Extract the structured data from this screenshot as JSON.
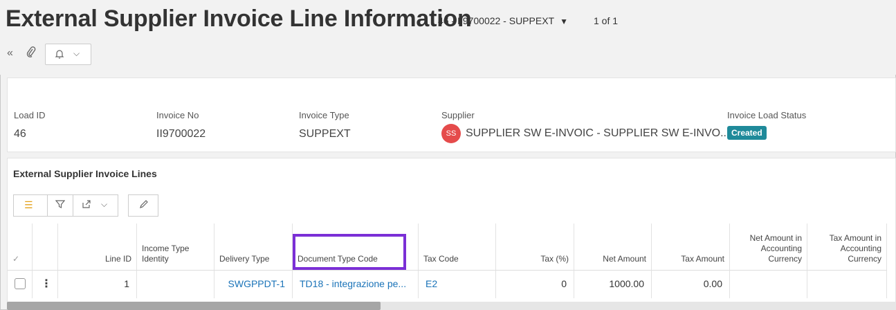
{
  "header": {
    "title": "External Supplier Invoice Line Information",
    "record_selector": "46 - II9700022 - SUPPEXT",
    "record_counter": "1 of 1"
  },
  "toolbar": {
    "icons": [
      "double-chevron-left-icon",
      "paperclip-icon",
      "notification-bell-icon",
      "chevron-down-icon"
    ]
  },
  "invoice": {
    "load_id": {
      "label": "Load ID",
      "value": "46"
    },
    "invoice_no": {
      "label": "Invoice No",
      "value": "II9700022"
    },
    "invoice_type": {
      "label": "Invoice Type",
      "value": "SUPPEXT"
    },
    "supplier": {
      "label": "Supplier",
      "avatar": "SS",
      "value": "SUPPLIER SW E-INVOIC - SUPPLIER SW E-INVO..."
    },
    "load_status": {
      "label": "Invoice Load Status",
      "value": "Created",
      "color": "#1f8a9a"
    }
  },
  "lines": {
    "title": "External Supplier Invoice Lines",
    "columns": {
      "line_id": "Line ID",
      "income_type": "Income Type Identity",
      "delivery_type": "Delivery Type",
      "doc_type_code": "Document Type Code",
      "tax_code": "Tax Code",
      "tax_pct": "Tax (%)",
      "net_amount": "Net Amount",
      "tax_amount": "Tax Amount",
      "net_acc": "Net Amount in Accounting Currency",
      "tax_acc": "Tax Amount in Accounting Currency"
    },
    "rows": [
      {
        "line_id": "1",
        "income_type": "",
        "delivery_type": "SWGPPDT-1",
        "doc_type_code": "TD18 - integrazione pe...",
        "tax_code": "E2",
        "tax_pct": "0",
        "net_amount": "1000.00",
        "tax_amount": "0.00",
        "net_acc": "",
        "tax_acc": ""
      }
    ]
  },
  "colors": {
    "highlight": "#7b2fd6",
    "link": "#1a73b8",
    "avatar": "#e54b4b"
  }
}
